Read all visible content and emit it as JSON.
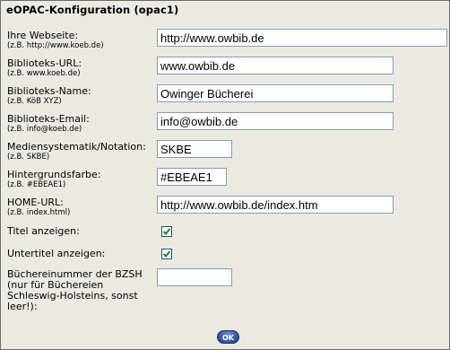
{
  "form": {
    "title": "eOPAC-Konfiguration (opac1)",
    "fields": {
      "website": {
        "label": "Ihre Webseite:",
        "hint": "(z.B. http://www.koeb.de)",
        "value": "http://www.owbib.de"
      },
      "bib_url": {
        "label": "Biblioteks-URL:",
        "hint": "(z.B. www.koeb.de)",
        "value": "www.owbib.de"
      },
      "bib_name": {
        "label": "Biblioteks-Name:",
        "hint": "(z.B. KöB XYZ)",
        "value": "Owinger Bücherei"
      },
      "bib_email": {
        "label": "Biblioteks-Email:",
        "hint": "(z.B. info@koeb.de)",
        "value": "info@owbib.de"
      },
      "mediensystematik": {
        "label": "Mediensystematik/Notation:",
        "hint": "(z.B. SKBE)",
        "value": "SKBE"
      },
      "hintergrundfarbe": {
        "label": "Hintergrundsfarbe:",
        "hint": "(z.B. #EBEAE1)",
        "value": "#EBEAE1"
      },
      "home_url": {
        "label": "HOME-URL:",
        "hint": "(z.B. index.html)",
        "value": "http://www.owbib.de/index.htm"
      },
      "titel_anzeigen": {
        "label": "Titel anzeigen:",
        "checked": true
      },
      "untertitel_anzeigen": {
        "label": "Untertitel anzeigen:",
        "checked": true
      },
      "buechereinummer": {
        "label_lines": [
          "Büchereinummer der BZSH",
          "(nur für Büchereien",
          "Schleswig-Holsteins, sonst",
          "leer!):"
        ],
        "value": ""
      }
    },
    "ok_label": "OK"
  },
  "colors": {
    "background": "#EBEAE1",
    "input_border": "#7f9db9",
    "checkmark": "#1b8a1b",
    "ok_button": "#2d4f9f"
  },
  "icons": {
    "checkbox": "checkmark-icon",
    "ok": "ok-button-icon"
  }
}
